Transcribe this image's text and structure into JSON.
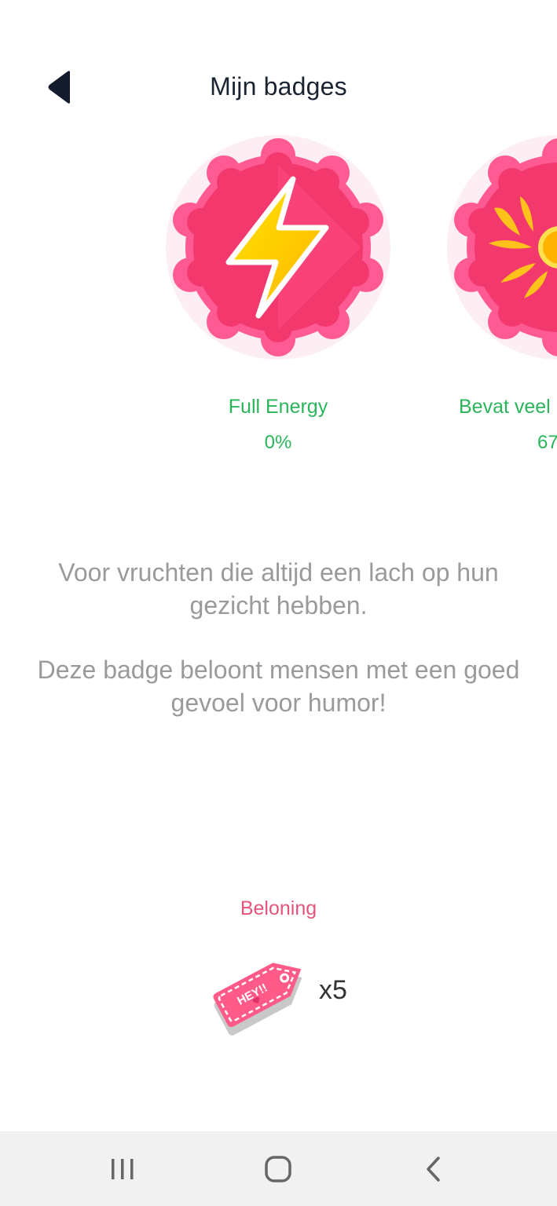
{
  "header": {
    "title": "Mijn badges",
    "back_icon": "back-triangle-icon"
  },
  "badges": [
    {
      "name": "Full Energy",
      "progress": "0%",
      "icon": "lightning-bolt-icon",
      "color": "#f2386d"
    },
    {
      "name": "Bevat veel",
      "progress": "67",
      "icon": "sun-rays-icon",
      "color": "#f2386d"
    }
  ],
  "description": {
    "line1": "Voor vruchten die altijd een lach op hun gezicht hebben.",
    "line2": "Deze badge beloont mensen met een goed gevoel voor humor!"
  },
  "reward": {
    "title": "Beloning",
    "tag_text": "HEY!!",
    "count": "x5",
    "icon": "price-tag-icon"
  },
  "navbar": {
    "recents_icon": "recents-icon",
    "home_icon": "home-icon",
    "back_icon": "nav-back-icon"
  },
  "colors": {
    "accent_green": "#2bb55a",
    "accent_pink": "#e5557b",
    "badge_pink": "#f2386d",
    "title_dark": "#1b2433",
    "text_gray": "#9a9a9a"
  }
}
